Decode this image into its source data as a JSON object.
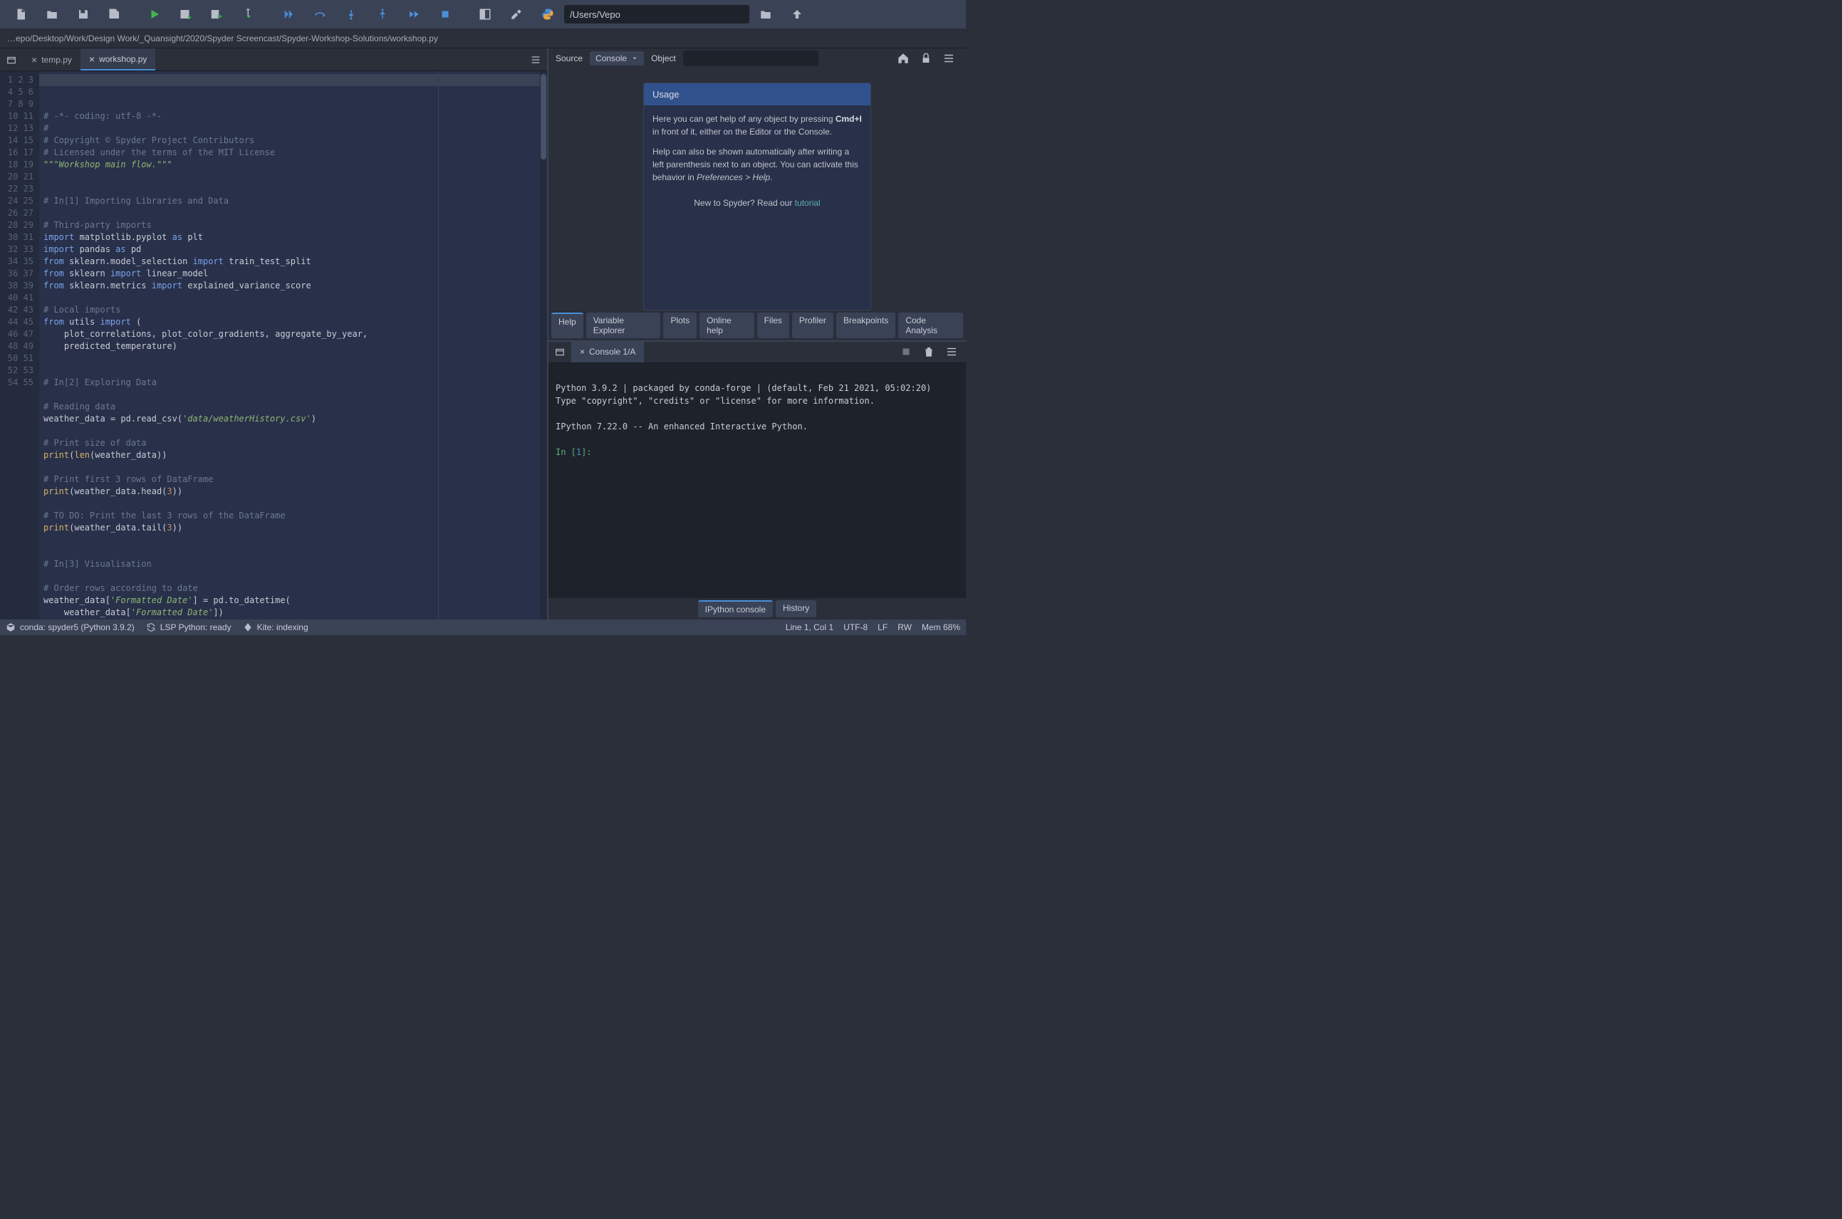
{
  "toolbar": {
    "path": "/Users/Vepo"
  },
  "breadcrumb": "…epo/Desktop/Work/Design Work/_Quansight/2020/Spyder Screencast/Spyder-Workshop-Solutions/workshop.py",
  "editor": {
    "tabs": [
      {
        "label": "temp.py",
        "active": false
      },
      {
        "label": "workshop.py",
        "active": true
      }
    ],
    "line_count": 55
  },
  "help": {
    "source_label": "Source",
    "source_value": "Console",
    "object_label": "Object",
    "card": {
      "title": "Usage",
      "p1_prefix": "Here you can get help of any object by pressing ",
      "p1_key": "Cmd+I",
      "p1_suffix": " in front of it, either on the Editor or the Console.",
      "p2_prefix": "Help can also be shown automatically after writing a left parenthesis next to an object. You can activate this behavior in ",
      "p2_em": "Preferences > Help",
      "p2_suffix": ".",
      "footer_prefix": "New to Spyder? Read our ",
      "footer_link": "tutorial"
    },
    "pane_tabs": [
      "Help",
      "Variable Explorer",
      "Plots",
      "Online help",
      "Files",
      "Profiler",
      "Breakpoints",
      "Code Analysis"
    ]
  },
  "console": {
    "tab_label": "Console 1/A",
    "line1": "Python 3.9.2 | packaged by conda-forge | (default, Feb 21 2021, 05:02:20)",
    "line2": "Type \"copyright\", \"credits\" or \"license\" for more information.",
    "line3": "IPython 7.22.0 -- An enhanced Interactive Python.",
    "prompt_label": "In [",
    "prompt_num": "1",
    "prompt_close": "]:",
    "bottom_tabs": [
      "IPython console",
      "History"
    ]
  },
  "statusbar": {
    "conda": "conda: spyder5 (Python 3.9.2)",
    "lsp": "LSP Python: ready",
    "kite": "Kite: indexing",
    "cursor": "Line 1, Col 1",
    "enc": "UTF-8",
    "eol": "LF",
    "perm": "RW",
    "mem": "Mem 68%"
  }
}
